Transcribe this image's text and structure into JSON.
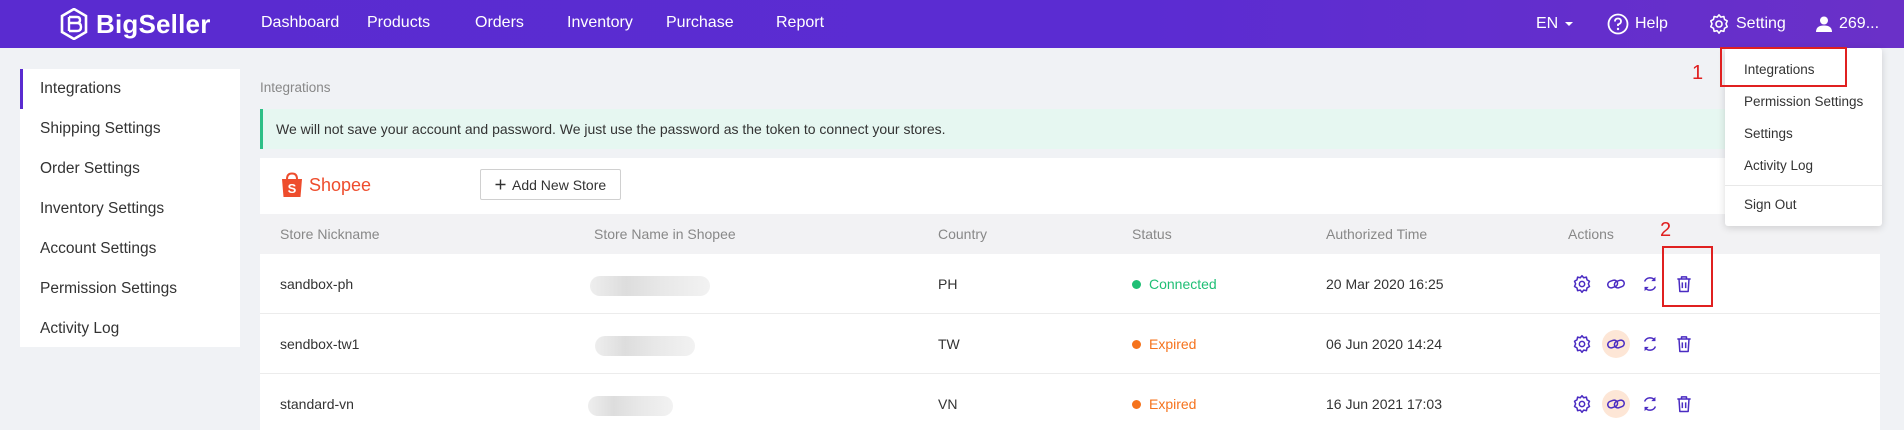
{
  "brand": {
    "name": "BigSeller"
  },
  "nav": [
    {
      "label": "Dashboard"
    },
    {
      "label": "Products"
    },
    {
      "label": "Orders"
    },
    {
      "label": "Inventory"
    },
    {
      "label": "Purchase"
    },
    {
      "label": "Report"
    }
  ],
  "topbar_right": {
    "lang": "EN",
    "help": "Help",
    "setting": "Setting",
    "user": "269..."
  },
  "sidebar": [
    {
      "label": "Integrations"
    },
    {
      "label": "Shipping Settings"
    },
    {
      "label": "Order Settings"
    },
    {
      "label": "Inventory Settings"
    },
    {
      "label": "Account Settings"
    },
    {
      "label": "Permission Settings"
    },
    {
      "label": "Activity Log"
    }
  ],
  "breadcrumb": "Integrations",
  "notice": "We will not save your account and password. We just use the password as the token to connect your stores.",
  "platform": {
    "name": "Shopee"
  },
  "add_store_label": "Add New Store",
  "table": {
    "columns": [
      "Store Nickname",
      "Store Name in Shopee",
      "Country",
      "Status",
      "Authorized Time",
      "Actions"
    ],
    "rows": [
      {
        "nickname": "sandbox-ph",
        "country": "PH",
        "status": "Connected",
        "time": "20 Mar 2020 16:25"
      },
      {
        "nickname": "sendbox-tw1",
        "country": "TW",
        "status": "Expired",
        "time": "06 Jun 2020 14:24"
      },
      {
        "nickname": "standard-vn",
        "country": "VN",
        "status": "Expired",
        "time": "16 Jun 2021 17:03"
      }
    ]
  },
  "colors": {
    "brand": "#5a2bd0",
    "connected": "#1fbf75",
    "expired": "#f5731d",
    "notice_bg": "#e6f7f1",
    "annotation": "#e02020"
  },
  "dropdown": [
    {
      "label": "Integrations"
    },
    {
      "label": "Permission Settings"
    },
    {
      "label": "Settings"
    },
    {
      "label": "Activity Log"
    },
    {
      "label": "Sign Out"
    }
  ],
  "annotations": {
    "step1": "1",
    "step2": "2"
  },
  "icons": [
    "gear-icon",
    "link-icon",
    "refresh-icon",
    "trash-icon",
    "help-icon",
    "user-icon",
    "chevron-down-icon",
    "plus-icon",
    "shopee-bag-icon"
  ]
}
